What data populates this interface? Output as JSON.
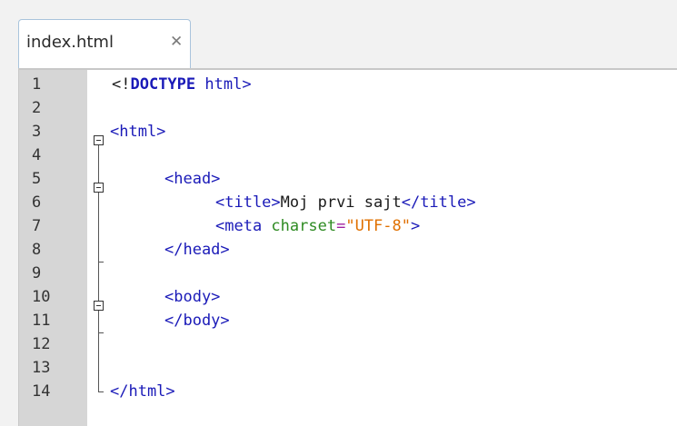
{
  "tab": {
    "label": "index.html",
    "close_glyph": "✕"
  },
  "line_numbers": [
    "1",
    "2",
    "3",
    "4",
    "5",
    "6",
    "7",
    "8",
    "9",
    "10",
    "11",
    "12",
    "13",
    "14"
  ],
  "code": {
    "l1_open": "<!",
    "l1_kw": "DOCTYPE",
    "l1_rest": " html>",
    "l3": "<html>",
    "l5": "<head>",
    "l6_open": "<title>",
    "l6_text": "Moj prvi sajt",
    "l6_close": "</title>",
    "l7_open": "<meta",
    "l7_attr": " charset",
    "l7_eq": "=",
    "l7_val": "\"UTF-8\"",
    "l7_close": ">",
    "l8": "</head>",
    "l10": "<body>",
    "l11": "</body>",
    "l13": "</html>"
  },
  "icons": {
    "fold": "fold-collapse-icon",
    "close": "close-icon"
  }
}
